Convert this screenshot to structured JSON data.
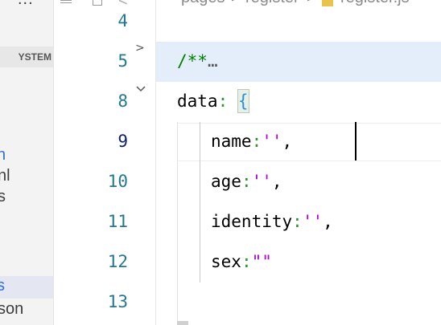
{
  "sidebar": {
    "more_label": "...",
    "section_label": "YSTEM",
    "fragments": [
      {
        "text": "n"
      },
      {
        "text": "nl"
      },
      {
        "text": "s"
      }
    ],
    "active_item": "s",
    "bottom_item": "son"
  },
  "breadcrumb": {
    "pages": "pages",
    "sep1": ">",
    "register_dir": "register",
    "sep2": ">",
    "file": "register.js"
  },
  "editor": {
    "lines": [
      {
        "num": "4"
      },
      {
        "num": "5"
      },
      {
        "num": "8"
      },
      {
        "num": "9"
      },
      {
        "num": "10"
      },
      {
        "num": "11"
      },
      {
        "num": "12"
      },
      {
        "num": "13"
      }
    ],
    "fold_collapsed": ">",
    "fold_expanded": "v",
    "code": {
      "comment": "/**",
      "ellipsis": "…",
      "data_key": "data",
      "colon": ":",
      "open_brace": "{",
      "name_key": "name",
      "age_key": "age",
      "identity_key": "identity",
      "sex_key": "sex",
      "empty_single": "''",
      "empty_double": "\"\"",
      "comma": ","
    }
  },
  "colors": {
    "line_number": "#237893",
    "comment": "#008000",
    "string": "#a31515",
    "fold_highlight": "#e4eefa"
  }
}
